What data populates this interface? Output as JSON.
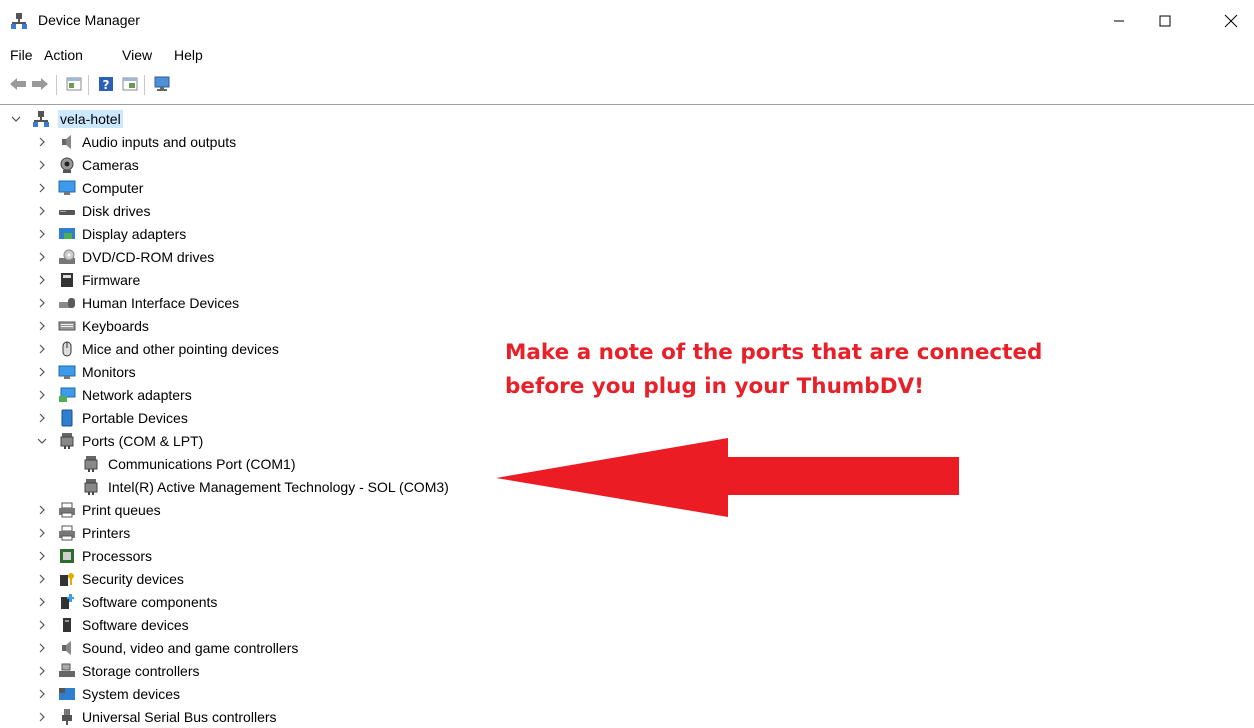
{
  "window": {
    "title": "Device Manager",
    "icon": "device-manager-icon"
  },
  "menu": [
    "File",
    "Action",
    "View",
    "Help"
  ],
  "toolbar": [
    "back-arrow-icon",
    "forward-arrow-icon",
    "properties-icon",
    "help-icon",
    "details-icon",
    "monitor-icon"
  ],
  "tree": {
    "root": "vela-hotel",
    "categories": [
      {
        "label": "Audio inputs and outputs",
        "icon": "speaker-icon"
      },
      {
        "label": "Cameras",
        "icon": "camera-icon"
      },
      {
        "label": "Computer",
        "icon": "computer-icon"
      },
      {
        "label": "Disk drives",
        "icon": "disk-drive-icon"
      },
      {
        "label": "Display adapters",
        "icon": "display-adapter-icon"
      },
      {
        "label": "DVD/CD-ROM drives",
        "icon": "dvd-icon"
      },
      {
        "label": "Firmware",
        "icon": "firmware-icon"
      },
      {
        "label": "Human Interface Devices",
        "icon": "hid-icon"
      },
      {
        "label": "Keyboards",
        "icon": "keyboard-icon"
      },
      {
        "label": "Mice and other pointing devices",
        "icon": "mouse-icon"
      },
      {
        "label": "Monitors",
        "icon": "monitor-icon"
      },
      {
        "label": "Network adapters",
        "icon": "network-icon"
      },
      {
        "label": "Portable Devices",
        "icon": "portable-device-icon"
      },
      {
        "label": "Ports (COM & LPT)",
        "icon": "port-icon",
        "expanded": true,
        "children": [
          "Communications Port (COM1)",
          "Intel(R) Active Management Technology - SOL (COM3)"
        ]
      },
      {
        "label": "Print queues",
        "icon": "printer-icon"
      },
      {
        "label": "Printers",
        "icon": "printer-icon"
      },
      {
        "label": "Processors",
        "icon": "processor-icon"
      },
      {
        "label": "Security devices",
        "icon": "security-icon"
      },
      {
        "label": "Software components",
        "icon": "software-component-icon"
      },
      {
        "label": "Software devices",
        "icon": "software-device-icon"
      },
      {
        "label": "Sound, video and game controllers",
        "icon": "sound-icon"
      },
      {
        "label": "Storage controllers",
        "icon": "storage-icon"
      },
      {
        "label": "System devices",
        "icon": "system-devices-icon"
      },
      {
        "label": "Universal Serial Bus controllers",
        "icon": "usb-icon"
      }
    ]
  },
  "annotation": {
    "line1": "Make a note of the ports that are connected",
    "line2": "before you plug in your ThumbDV!",
    "color": "#e8202a"
  },
  "colors": {
    "selection": "#cce8ff",
    "annotation": "#e8202a"
  }
}
